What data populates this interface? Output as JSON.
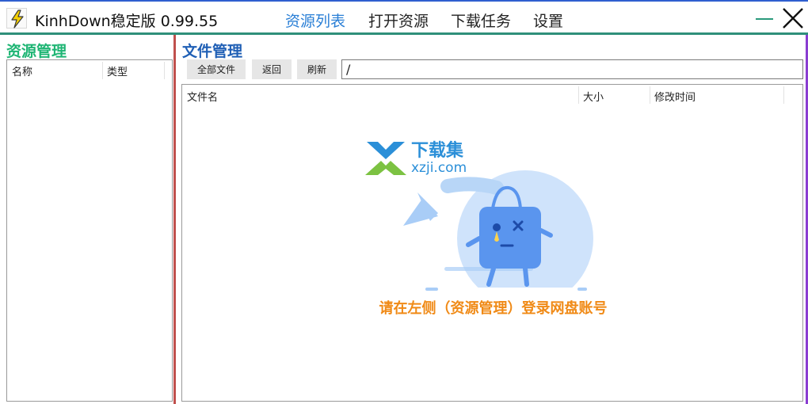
{
  "titlebar": {
    "app_title": "KinhDown稳定版 0.99.55",
    "menu": [
      "资源列表",
      "打开资源",
      "下载任务",
      "设置"
    ],
    "active_menu_index": 0
  },
  "left_panel": {
    "title": "资源管理",
    "columns": [
      "名称",
      "类型"
    ]
  },
  "right_panel": {
    "title": "文件管理",
    "toolbar": {
      "all_files_label": "全部文件",
      "back_label": "返回",
      "refresh_label": "刷新",
      "path_value": "/"
    },
    "columns": [
      "文件名",
      "大小",
      "修改时间"
    ],
    "watermark_brand": "下载集",
    "watermark_url": "xzji.com",
    "empty_hint": "请在左侧（资源管理）登录网盘账号"
  },
  "colors": {
    "accent_blue": "#2a7fd6",
    "green_title": "#1fb574",
    "blue_title": "#1f5fb5",
    "orange_hint": "#f08a16",
    "left_divider": "#c0504d",
    "right_border": "#8a3dd1"
  },
  "icons": [
    "lightning-bolt-icon",
    "minimize-icon",
    "close-icon",
    "watermark-logo-icon",
    "empty-state-mascot-icon"
  ]
}
